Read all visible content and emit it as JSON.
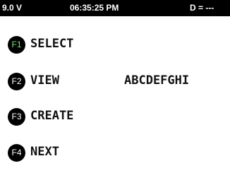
{
  "status_bar": {
    "voltage": "9.0 V",
    "time": "06:35:25 PM",
    "d_readout": "D = ---"
  },
  "menu": [
    {
      "key": "F1",
      "label": "SELECT",
      "value": "",
      "selected": true,
      "key_text_color": "#7ee07e"
    },
    {
      "key": "F2",
      "label": "VIEW",
      "value": "ABCDEFGHI",
      "selected": false
    },
    {
      "key": "F3",
      "label": "CREATE",
      "value": "",
      "selected": false
    },
    {
      "key": "F4",
      "label": "NEXT",
      "value": "",
      "selected": false
    }
  ],
  "colors": {
    "background": "#ffffff",
    "status_bar": "#000000",
    "key_badge": "#000000",
    "selected_key_text": "#7ee07e"
  },
  "icons": {
    "function_key_badge": "filled-circle"
  }
}
